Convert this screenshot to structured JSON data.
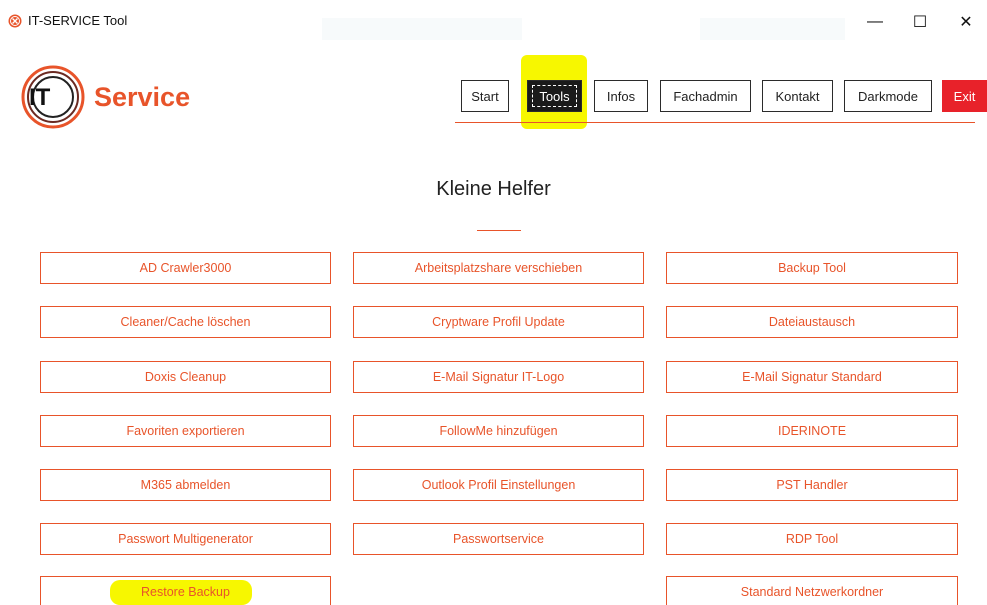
{
  "window": {
    "title": "IT-SERVICE Tool",
    "minimize": "—",
    "maximize": "☐",
    "close": "✕"
  },
  "logo": {
    "it": "IT",
    "service": "Service"
  },
  "nav": {
    "start": "Start",
    "tools": "Tools",
    "infos": "Infos",
    "fachadmin": "Fachadmin",
    "kontakt": "Kontakt",
    "darkmode": "Darkmode",
    "exit": "Exit"
  },
  "main": {
    "heading": "Kleine Helfer",
    "tools": [
      "AD Crawler3000",
      "Arbeitsplatzshare verschieben",
      "Backup Tool",
      "Cleaner/Cache löschen",
      "Cryptware Profil Update",
      "Dateiaustausch",
      "Doxis Cleanup",
      "E-Mail Signatur IT-Logo",
      "E-Mail Signatur Standard",
      "Favoriten exportieren",
      "FollowMe hinzufügen",
      "IDERINOTE",
      "M365 abmelden",
      "Outlook Profil Einstellungen",
      "PST Handler",
      "Passwort Multigenerator",
      "Passwortservice",
      "RDP Tool",
      "Restore Backup",
      "Standard Netzwerkordner"
    ]
  },
  "colors": {
    "accent": "#e8542a",
    "exit": "#e8222a",
    "highlight": "#f7f700"
  }
}
